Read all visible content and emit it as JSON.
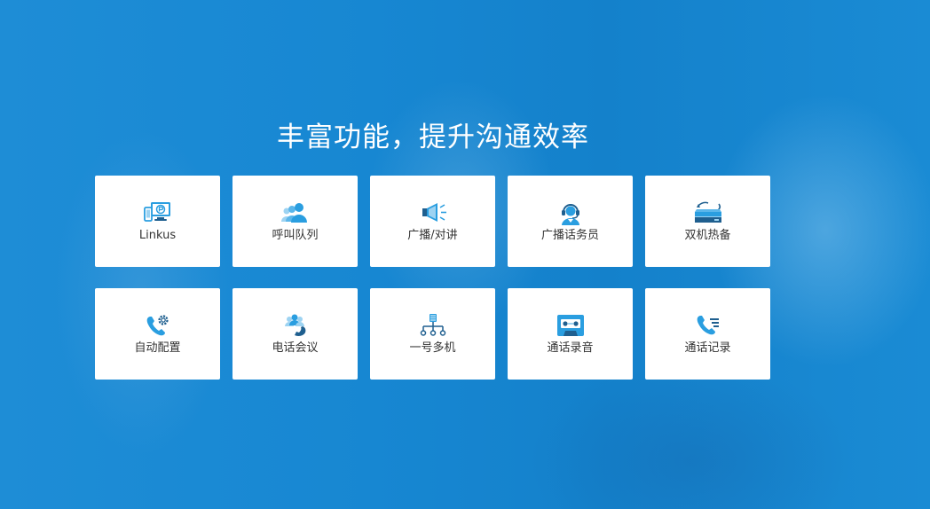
{
  "heading": "丰富功能，提升沟通效率",
  "colors": {
    "background": "#1a86cf",
    "icon_primary": "#2a9ee0",
    "icon_dark": "#1f5f8f",
    "card": "#ffffff",
    "label": "#333333"
  },
  "features": [
    {
      "label": "Linkus",
      "icon": "linkus-devices-icon"
    },
    {
      "label": "呼叫队列",
      "icon": "call-queue-people-icon"
    },
    {
      "label": "广播/对讲",
      "icon": "megaphone-icon"
    },
    {
      "label": "广播话务员",
      "icon": "headset-operator-icon"
    },
    {
      "label": "双机热备",
      "icon": "server-failover-icon"
    },
    {
      "label": "自动配置",
      "icon": "phone-gear-icon"
    },
    {
      "label": "电话会议",
      "icon": "conference-call-icon"
    },
    {
      "label": "一号多机",
      "icon": "one-number-multi-device-icon"
    },
    {
      "label": "通话录音",
      "icon": "cassette-recording-icon"
    },
    {
      "label": "通话记录",
      "icon": "call-log-icon"
    }
  ]
}
